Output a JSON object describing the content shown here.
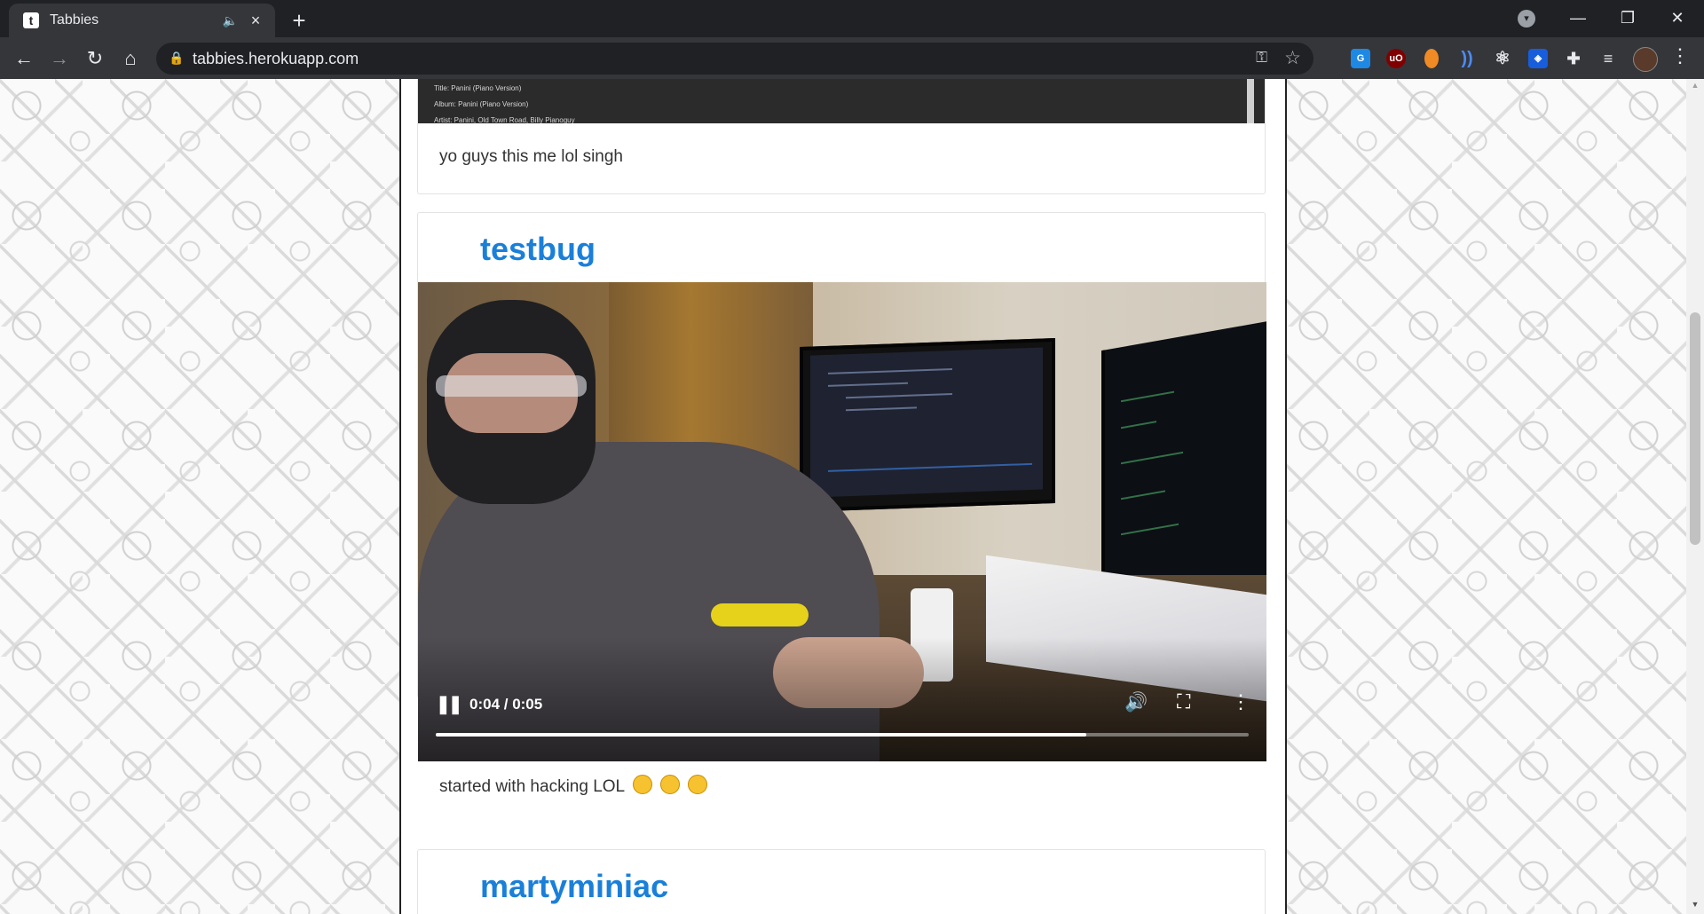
{
  "browser": {
    "tab": {
      "favicon": "t",
      "title": "Tabbies",
      "audio_icon": "speaker-icon",
      "close": "×"
    },
    "new_tab": "+",
    "window_controls": {
      "minimize": "—",
      "restore": "❐",
      "close": "✕"
    },
    "url": "tabbies.herokuapp.com",
    "extensions": [
      "translate-ext",
      "ublock-ext",
      "honey-ext",
      "dictionary-ext",
      "react-devtools-ext",
      "bitwarden-ext",
      "puzzle-ext",
      "reading-list-ext"
    ]
  },
  "feed": {
    "posts": [
      {
        "media_meta": [
          "Title: Panini (Piano Version)",
          "Album: Panini (Piano Version)",
          "Artist: Panini, Old Town Road, Billy Pianoguy"
        ],
        "caption": "yo guys this me lol singh"
      },
      {
        "username": "testbug",
        "video": {
          "time": "0:04 / 0:05",
          "progress": 0.8
        },
        "caption": "started with hacking LOL"
      },
      {
        "username": "martyminiac"
      }
    ]
  }
}
